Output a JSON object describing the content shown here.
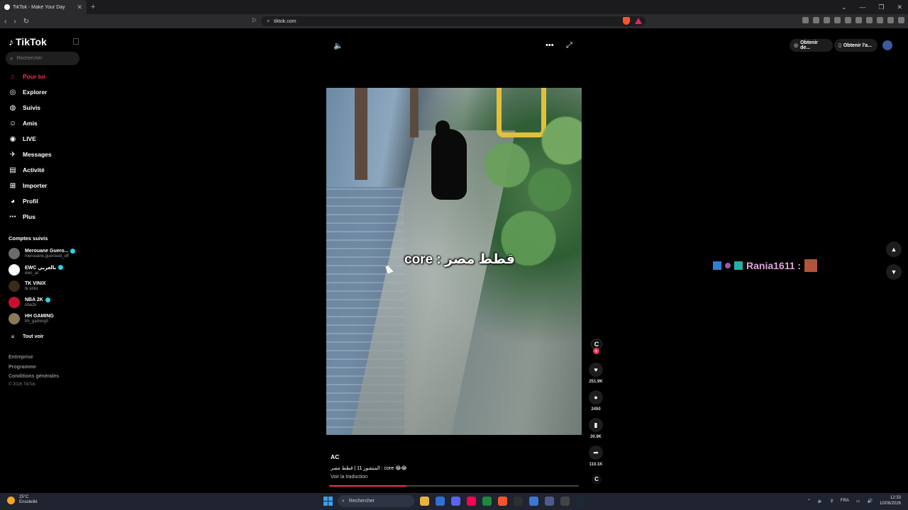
{
  "browser": {
    "tab_title": "TikTok - Make Your Day",
    "url": "tiktok.com",
    "new_tab": "+",
    "close": "✕"
  },
  "sidebar": {
    "logo": "TikTok",
    "search_placeholder": "Rechercher",
    "nav": [
      {
        "label": "Pour toi",
        "icon": "home-icon",
        "active": true
      },
      {
        "label": "Explorer",
        "icon": "compass-icon"
      },
      {
        "label": "Suivis",
        "icon": "following-icon"
      },
      {
        "label": "Amis",
        "icon": "friends-icon"
      },
      {
        "label": "LIVE",
        "icon": "live-icon"
      },
      {
        "label": "Messages",
        "icon": "messages-icon"
      },
      {
        "label": "Activité",
        "icon": "activity-icon"
      },
      {
        "label": "Importer",
        "icon": "upload-icon"
      },
      {
        "label": "Profil",
        "icon": "profile-icon"
      },
      {
        "label": "Plus",
        "icon": "more-icon"
      }
    ],
    "following_title": "Comptes suivis",
    "following": [
      {
        "name": "Merouane Guero...",
        "handle": "merouane.gueroudi_off",
        "verified": true,
        "color": "#6b6b6b"
      },
      {
        "name": "EWC بالعربي",
        "handle": "ewc_ar",
        "verified": true,
        "color": "#ffffff"
      },
      {
        "name": "TK VINIX",
        "handle": "tk.vinix",
        "verified": false,
        "color": "#3a2a1a"
      },
      {
        "name": "NBA 2K",
        "handle": "nba2k",
        "verified": true,
        "color": "#c8102e"
      },
      {
        "name": "HH GAMING",
        "handle": "hh_gaming0",
        "verified": false,
        "color": "#8a7a5a"
      }
    ],
    "see_all": "Tout voir",
    "footer": [
      "Entreprise",
      "Programme",
      "Conditions générales"
    ],
    "copyright": "© 2026 TikTok"
  },
  "video": {
    "caption": "قطط مصر : core",
    "author": "AC",
    "description": "المنشور 11 | قطط مصر : core 😂😂",
    "translate": "Voir la traduction",
    "progress": 0.31,
    "likes": "251.9K",
    "comments": "2450",
    "saves": "30.9K",
    "shares": "110.1K"
  },
  "header_right": {
    "get_coins": "Obtenir de...",
    "get_app": "Obtenir l'a..."
  },
  "live_overlay": {
    "user": "Rania1611 :"
  },
  "taskbar": {
    "temp": "25°C",
    "weather": "Ensoleillé",
    "search": "Rechercher",
    "lang": "FRA",
    "time": "12:33",
    "date": "10/08/2026"
  }
}
